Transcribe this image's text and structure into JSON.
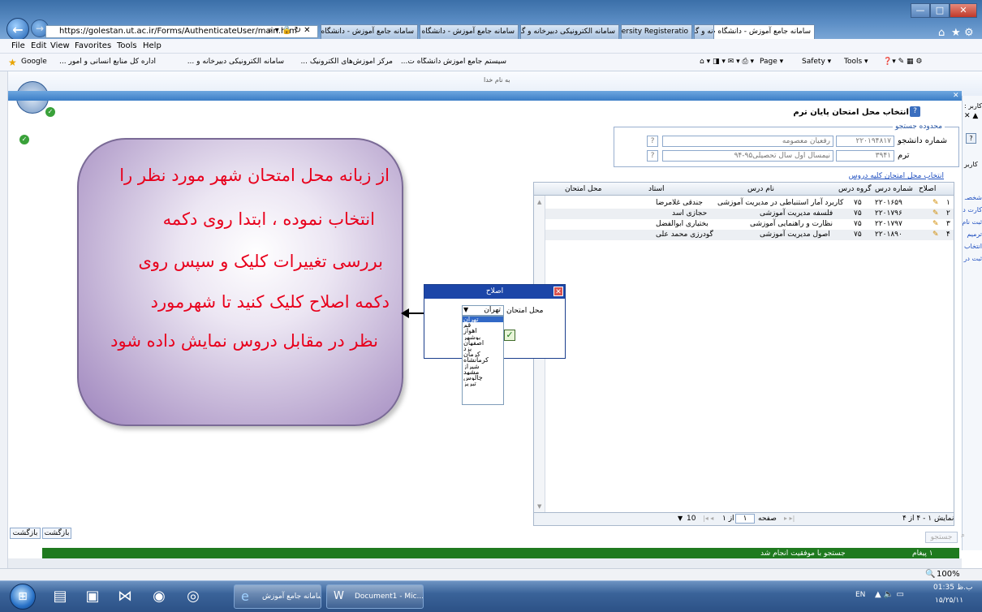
{
  "browser": {
    "url": "https://golestan.ut.ac.ir/Forms/AuthenticateUser/main.htm",
    "tabs": [
      "سامانه جامع آموزش - دانشگاه تهرا...",
      "سامانه جامع آموزش - دانشگاه تهرا...",
      "سامانه الکترونیکی دبیرخانه و گرد...",
      "Tehran University Registeratio...",
      "سامانه الکترونیکی دبیرخانه و گرد...",
      "سامانه جامع آموزش - دانشگاه ت..."
    ],
    "menu": [
      "File",
      "Edit",
      "View",
      "Favorites",
      "Tools",
      "Help"
    ],
    "favorites": [
      "Google",
      "اداره کل منابع انسانی و امور ...",
      "سامانه الکترونیکی دبیرخانه و ...",
      "مرکز آموزش‌های الکترونیک ...",
      "سیستم جامع آموزش دانشگاه ت..."
    ],
    "commands": [
      "Page ▾",
      "Safety ▾",
      "Tools ▾"
    ],
    "zoom": "100%",
    "inner_caption": "به نام خدا"
  },
  "page": {
    "title": "انتخاب محل امتحان پایان ترم",
    "filter_legend": "محدوده جستجو",
    "student_label": "شماره دانشجو",
    "student_id": "۲۲۰۱۹۴۸۱۷",
    "student_name": "رفعیان معصومه",
    "term_label": "ترم",
    "term_code": "۳۹۴۱",
    "term_name": "نیمسال اول سال تحصیلی۹۵-۹۴",
    "all_courses_link": "انتخاب محل امتحان کلیه دروس",
    "right_side_label_user": "کاربر : ع",
    "right_side_label_user2": "کاربر"
  },
  "grid": {
    "headers": [
      "اصلاح",
      "شماره درس",
      "گروه درس",
      "نام درس",
      "استاد",
      "محل امتحان"
    ],
    "rows": [
      {
        "num": "۱",
        "code": "۲۲۰۱۶۵۹",
        "group": "۷۵",
        "name": "کاربرد آمار استنباطی در مدیریت آموزشی",
        "teacher": "جندقی غلامرضا",
        "place": ""
      },
      {
        "num": "۲",
        "code": "۲۲۰۱۷۹۶",
        "group": "۷۵",
        "name": "فلسفه مدیریت آموزشی",
        "teacher": "حجازی اسد",
        "place": ""
      },
      {
        "num": "۳",
        "code": "۲۲۰۱۷۹۷",
        "group": "۷۵",
        "name": "نظارت و راهنمایی آموزشی",
        "teacher": "بختیاری ابوالفضل",
        "place": ""
      },
      {
        "num": "۴",
        "code": "۲۲۰۱۸۹۰",
        "group": "۷۵",
        "name": "اصول مدیریت آموزشی",
        "teacher": "گودرزی محمد علی",
        "place": ""
      }
    ],
    "pager": {
      "page_size": "10",
      "page_label": "صفحه",
      "page_value": "۱",
      "of_label": "از ۱",
      "summary": "نمایش ۱ - ۴ از ۴"
    }
  },
  "dialog": {
    "title": "اصلاح",
    "label": "محل امتحان",
    "selected": "تهران",
    "options": [
      "تهران",
      "قم",
      "اهواز",
      "بوشهر",
      "اصفهان",
      "یزد",
      "کرمان",
      "کرمانشاه",
      "شیراز",
      "مشهد",
      "چالوس",
      "تبریز"
    ]
  },
  "callout": {
    "lines": [
      "از زبانه محل امتحان شهر مورد نظر را",
      "انتخاب نموده ، ابتدا روی دکمه",
      "بررسی تغییرات کلیک و سپس روی",
      "دکمه اصلاح کلیک کنید تا شهرمورد",
      "نظر در مقابل دروس نمایش داده شود"
    ]
  },
  "footer": {
    "back_label": "بازگشت",
    "back_label2": "بازگشت",
    "search_label": "جستجو",
    "status_message": "جستجو با موفقیت انجام شد",
    "message_count": "۱ پیغام"
  },
  "taskbar": {
    "task1": "سامانه جامع آموزش ...",
    "task2": "Document1 - Mic...",
    "lang": "EN",
    "time": "01:35 ب.ظ",
    "date": "۱۵/۲۵/۱۱"
  },
  "colors": {
    "accent_blue": "#1c46a8",
    "status_green": "#1f7a1f",
    "callout_text": "#e8001c"
  }
}
